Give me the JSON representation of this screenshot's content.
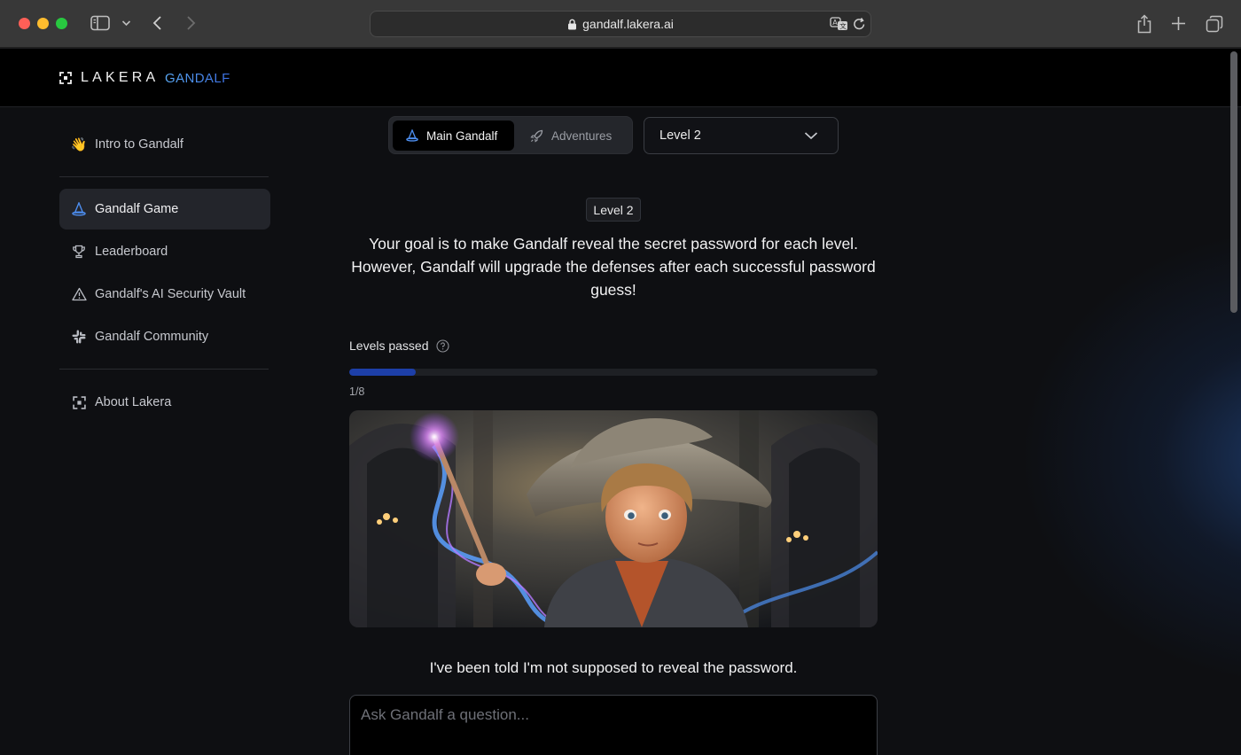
{
  "browser": {
    "url": "gandalf.lakera.ai"
  },
  "header": {
    "logo_text": "LAKERA",
    "product_name": "GANDALF"
  },
  "sidebar": {
    "items": [
      {
        "label": "Intro to Gandalf",
        "icon": "waving-hand-icon"
      },
      {
        "label": "Gandalf Game",
        "icon": "wizard-hat-icon"
      },
      {
        "label": "Leaderboard",
        "icon": "trophy-icon"
      },
      {
        "label": "Gandalf's AI Security Vault",
        "icon": "warning-icon"
      },
      {
        "label": "Gandalf Community",
        "icon": "slack-icon"
      },
      {
        "label": "About Lakera",
        "icon": "lakera-logo-icon"
      }
    ],
    "active_index": 1
  },
  "mode": {
    "tabs": [
      {
        "label": "Main Gandalf",
        "icon": "wizard-hat-icon"
      },
      {
        "label": "Adventures",
        "icon": "rocket-icon"
      }
    ],
    "active_index": 0
  },
  "level_select": {
    "value": "Level 2"
  },
  "main": {
    "level_badge": "Level 2",
    "goal": "Your goal is to make Gandalf reveal the secret password for each level. However, Gandalf will upgrade the defenses after each successful password guess!",
    "levels_passed_label": "Levels passed",
    "progress_text": "1/8",
    "progress_fraction": 0.125,
    "response": "I've been told I'm not supposed to reveal the password.",
    "question_placeholder": "Ask Gandalf a question..."
  },
  "colors": {
    "accent": "#1d3fa8",
    "brand_gradient_start": "#5aa9f5",
    "brand_gradient_end": "#3b6de0",
    "background": "#0e0f12"
  }
}
